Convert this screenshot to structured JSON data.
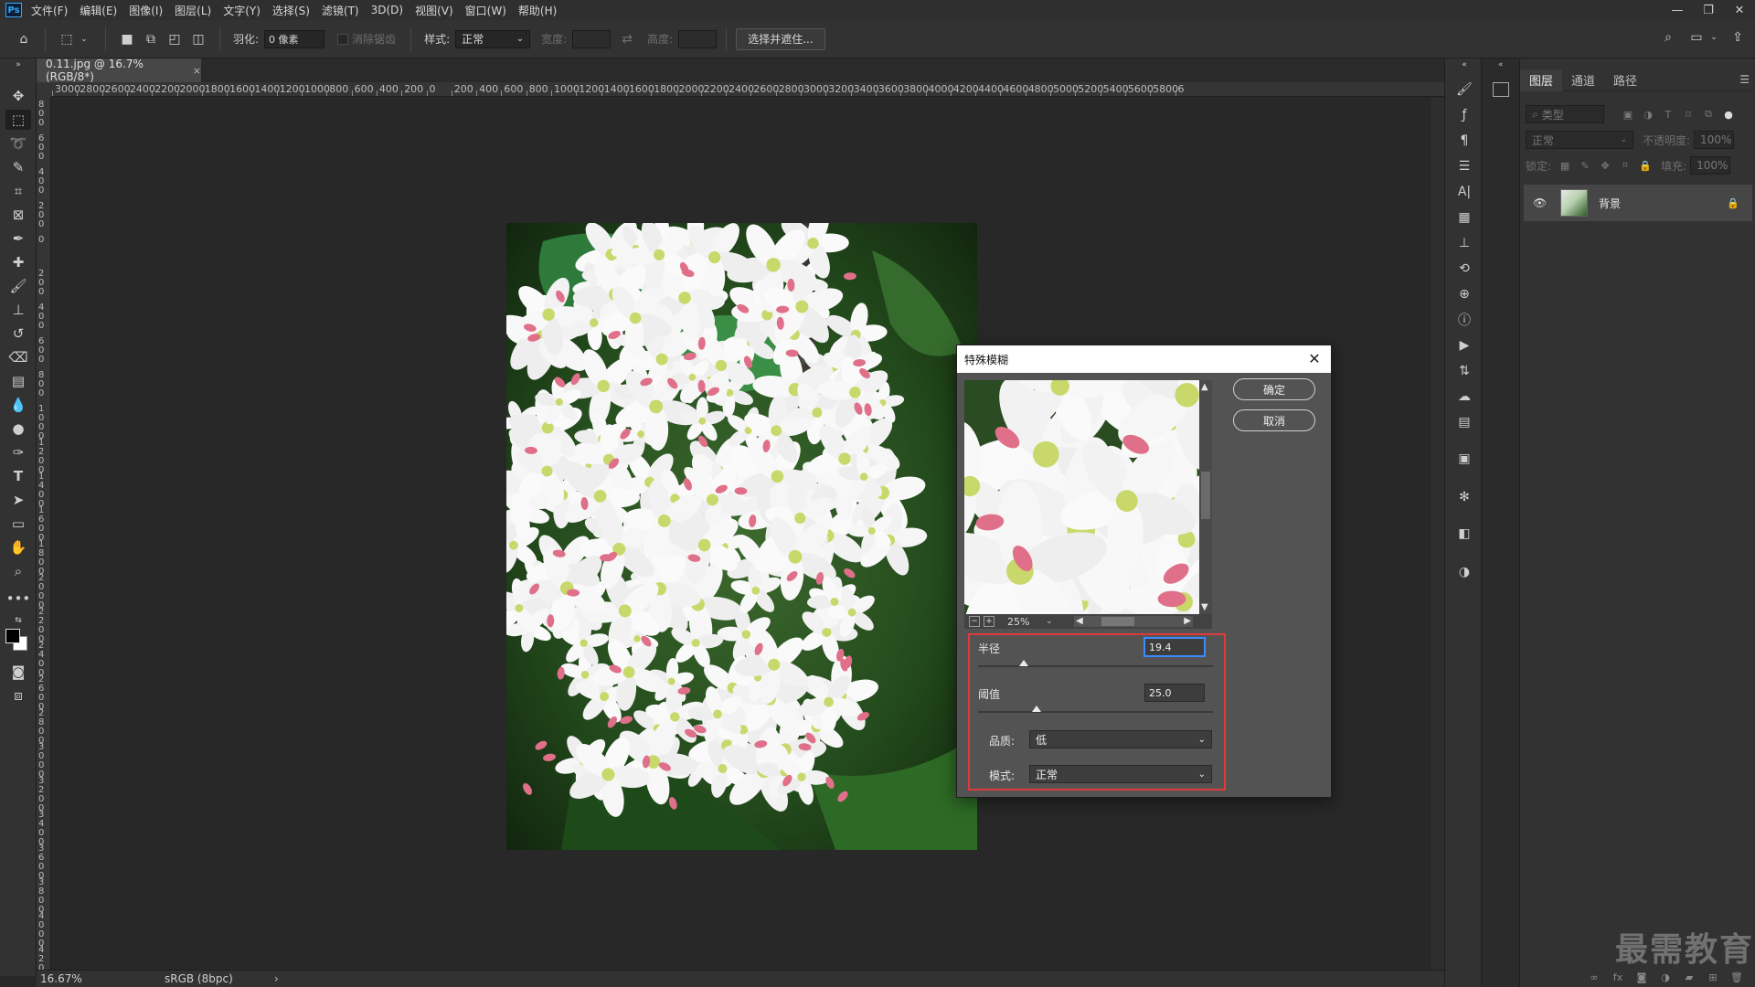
{
  "menu": {
    "logo": "Ps",
    "items": [
      "文件(F)",
      "编辑(E)",
      "图像(I)",
      "图层(L)",
      "文字(Y)",
      "选择(S)",
      "滤镜(T)",
      "3D(D)",
      "视图(V)",
      "窗口(W)",
      "帮助(H)"
    ]
  },
  "window_controls": {
    "minimize": "—",
    "restore": "❐",
    "close": "✕"
  },
  "options": {
    "feather_label": "羽化:",
    "feather_value": "0 像素",
    "antialias_label": "消除锯齿",
    "style_label": "样式:",
    "style_value": "正常",
    "width_label": "宽度:",
    "height_label": "高度:",
    "select_mask_button": "选择并遮住..."
  },
  "document": {
    "tab_title": "0.11.jpg @ 16.7%(RGB/8*)",
    "tab_close": "×"
  },
  "ruler": {
    "h_labels": [
      "3000",
      "2800",
      "2600",
      "2400",
      "2200",
      "2000",
      "1800",
      "1600",
      "1400",
      "1200",
      "1000",
      "800",
      "600",
      "400",
      "200",
      "0",
      "200",
      "400",
      "600",
      "800",
      "1000",
      "1200",
      "1400",
      "1600",
      "1800",
      "2000",
      "2200",
      "2400",
      "2600",
      "2800",
      "3000",
      "3200",
      "3400",
      "3600",
      "3800",
      "4000",
      "4200",
      "4400",
      "4600",
      "4800",
      "5000",
      "5200",
      "5400",
      "5600",
      "5800",
      "6"
    ],
    "v_labels": [
      "800",
      "600",
      "400",
      "200",
      "0",
      "200",
      "400",
      "600",
      "800",
      "1000",
      "1200",
      "1400",
      "1600",
      "1800",
      "2000",
      "2200",
      "2400",
      "2600",
      "2800",
      "3000",
      "3200",
      "3400",
      "3600",
      "3800",
      "4000",
      "4200"
    ]
  },
  "status": {
    "zoom": "16.67%",
    "profile": "sRGB (8bpc)",
    "arrow": "›"
  },
  "layers_panel": {
    "tabs": [
      "图层",
      "通道",
      "路径"
    ],
    "active_tab": "图层",
    "filter_placeholder": "类型",
    "blend_mode": "正常",
    "opacity_label": "不透明度:",
    "opacity_value": "100%",
    "lock_label": "锁定:",
    "fill_label": "填充:",
    "fill_value": "100%",
    "layer_name": "背景"
  },
  "watermark": "最需教育",
  "dialog": {
    "title": "特殊模糊",
    "ok_button": "确定",
    "cancel_button": "取消",
    "preview_zoom": "25%",
    "radius_label": "半径",
    "radius_value": "19.4",
    "radius_fraction": 0.194,
    "threshold_label": "阈值",
    "threshold_value": "25.0",
    "threshold_fraction": 0.25,
    "quality_label": "品质:",
    "quality_value": "低",
    "mode_label": "模式:",
    "mode_value": "正常"
  },
  "colors": {
    "accent_blue": "#31a8ff",
    "highlight_red": "#e03a3a",
    "panel_bg": "#323232",
    "canvas_bg": "#282828"
  }
}
